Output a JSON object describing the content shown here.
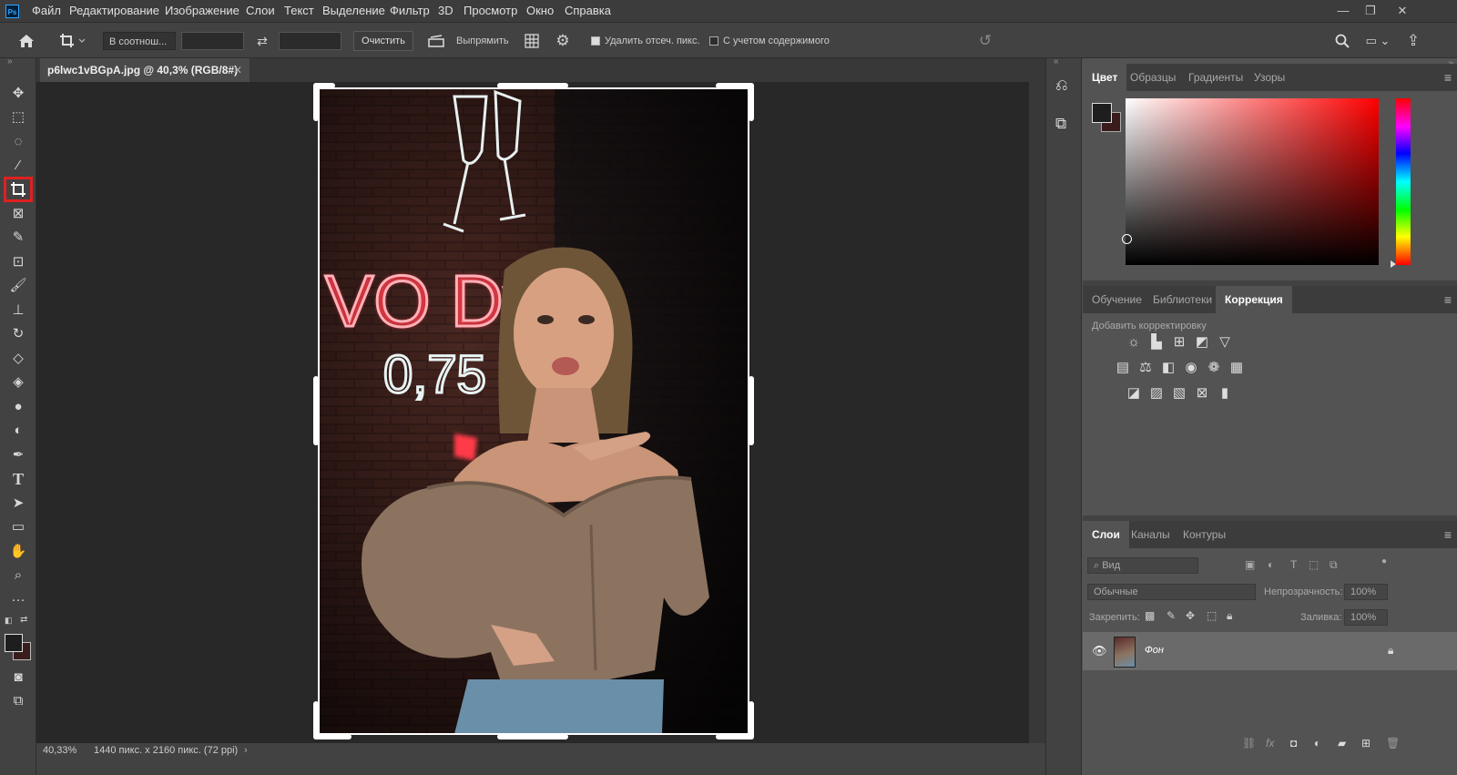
{
  "app": {
    "logo": "Ps"
  },
  "menu": [
    "Файл",
    "Редактирование",
    "Изображение",
    "Слои",
    "Текст",
    "Выделение",
    "Фильтр",
    "3D",
    "Просмотр",
    "Окно",
    "Справка"
  ],
  "window_controls": {
    "minimize": "—",
    "restore": "❐",
    "close": "✕"
  },
  "options": {
    "ratio_select": "В соотнош...",
    "clear_button": "Очистить",
    "straighten_label": "Выпрямить",
    "delete_cropped_label": "Удалить отсеч. пикс.",
    "delete_cropped_checked": true,
    "content_aware_label": "С учетом содержимого",
    "content_aware_checked": false
  },
  "document": {
    "tab_title": "p6lwc1vBGpA.jpg @ 40,3% (RGB/8#)",
    "zoom": "40,33%",
    "dimensions": "1440 пикс. x 2160 пикс. (72 ppi)"
  },
  "photo": {
    "neon_line1": "VO Dv",
    "neon_line2": "0,75 pl"
  },
  "color_panel": {
    "tabs": [
      "Цвет",
      "Образцы",
      "Градиенты",
      "Узоры"
    ],
    "active_tab": "Цвет",
    "hue_color": "#ff0000",
    "foreground": "#1e1e1e",
    "background": "#3a1c1c"
  },
  "adjust_panel": {
    "tabs": [
      "Обучение",
      "Библиотеки",
      "Коррекция"
    ],
    "active_tab": "Коррекция",
    "subtitle": "Добавить корректировку"
  },
  "layers_panel": {
    "tabs": [
      "Слои",
      "Каналы",
      "Контуры"
    ],
    "active_tab": "Слои",
    "search_placeholder": "Вид",
    "blend_mode": "Обычные",
    "opacity_label": "Непрозрачность:",
    "opacity_value": "100%",
    "lock_label": "Закрепить:",
    "fill_label": "Заливка:",
    "fill_value": "100%",
    "layers": [
      {
        "name": "Фон",
        "visible": true,
        "locked": true
      }
    ]
  }
}
